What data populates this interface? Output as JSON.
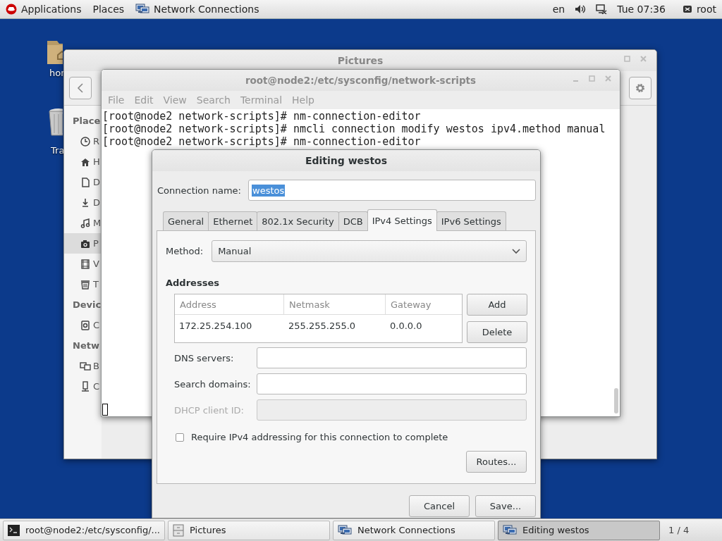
{
  "top_bar": {
    "applications": "Applications",
    "places": "Places",
    "app_name": "Network Connections",
    "keyboard": "en",
    "clock": "Tue 07:36",
    "user": "root"
  },
  "desktop_icons": [
    {
      "label": "hor"
    },
    {
      "label": "Tra"
    }
  ],
  "files_window": {
    "title": "Pictures",
    "sidebar": [
      {
        "kind": "heading",
        "label": "Place"
      },
      {
        "kind": "item",
        "label": "R",
        "selected": false
      },
      {
        "kind": "item",
        "label": "H",
        "selected": false
      },
      {
        "kind": "item",
        "label": "D",
        "selected": false
      },
      {
        "kind": "item",
        "label": "D",
        "selected": false
      },
      {
        "kind": "item",
        "label": "M",
        "selected": false
      },
      {
        "kind": "item",
        "label": "P",
        "selected": true
      },
      {
        "kind": "item",
        "label": "V",
        "selected": false
      },
      {
        "kind": "item",
        "label": "T",
        "selected": false
      },
      {
        "kind": "heading",
        "label": "Devic"
      },
      {
        "kind": "item",
        "label": "C",
        "selected": false
      },
      {
        "kind": "heading",
        "label": "Netw"
      },
      {
        "kind": "item",
        "label": "B",
        "selected": false
      },
      {
        "kind": "item",
        "label": "C",
        "selected": false
      }
    ]
  },
  "terminal": {
    "title": "root@node2:/etc/sysconfig/network-scripts",
    "menu": [
      "File",
      "Edit",
      "View",
      "Search",
      "Terminal",
      "Help"
    ],
    "lines": [
      "[root@node2 network-scripts]# nm-connection-editor",
      "[root@node2 network-scripts]# nmcli connection modify westos ipv4.method manual",
      "[root@node2 network-scripts]# nm-connection-editor"
    ]
  },
  "dialog": {
    "title": "Editing westos",
    "connection_name_label": "Connection name:",
    "connection_name": "westos",
    "connection_name_selected": true,
    "tabs": [
      {
        "label": "General",
        "selected": false
      },
      {
        "label": "Ethernet",
        "selected": false
      },
      {
        "label": "802.1x Security",
        "selected": false
      },
      {
        "label": "DCB",
        "selected": false
      },
      {
        "label": "IPv4 Settings",
        "selected": true
      },
      {
        "label": "IPv6 Settings",
        "selected": false
      }
    ],
    "method_label": "Method:",
    "method": "Manual",
    "addresses_heading": "Addresses",
    "table": {
      "columns": [
        "Address",
        "Netmask",
        "Gateway"
      ],
      "rows": [
        [
          "172.25.254.100",
          "255.255.255.0",
          "0.0.0.0"
        ]
      ]
    },
    "add_button": "Add",
    "delete_button": "Delete",
    "fields": [
      {
        "label": "DNS servers:",
        "disabled": false
      },
      {
        "label": "Search domains:",
        "disabled": false
      },
      {
        "label": "DHCP client ID:",
        "disabled": true
      }
    ],
    "require_checkbox": {
      "label": "Require IPv4 addressing for this connection to complete",
      "checked": false
    },
    "routes_button": "Routes...",
    "cancel_button": "Cancel",
    "save_button": "Save..."
  },
  "taskbar": {
    "items": [
      {
        "label": "root@node2:/etc/sysconfig/...",
        "selected": false
      },
      {
        "label": "Pictures",
        "selected": false
      },
      {
        "label": "Network Connections",
        "selected": false
      },
      {
        "label": "Editing westos",
        "selected": true
      }
    ],
    "workspace": "1 / 4"
  }
}
